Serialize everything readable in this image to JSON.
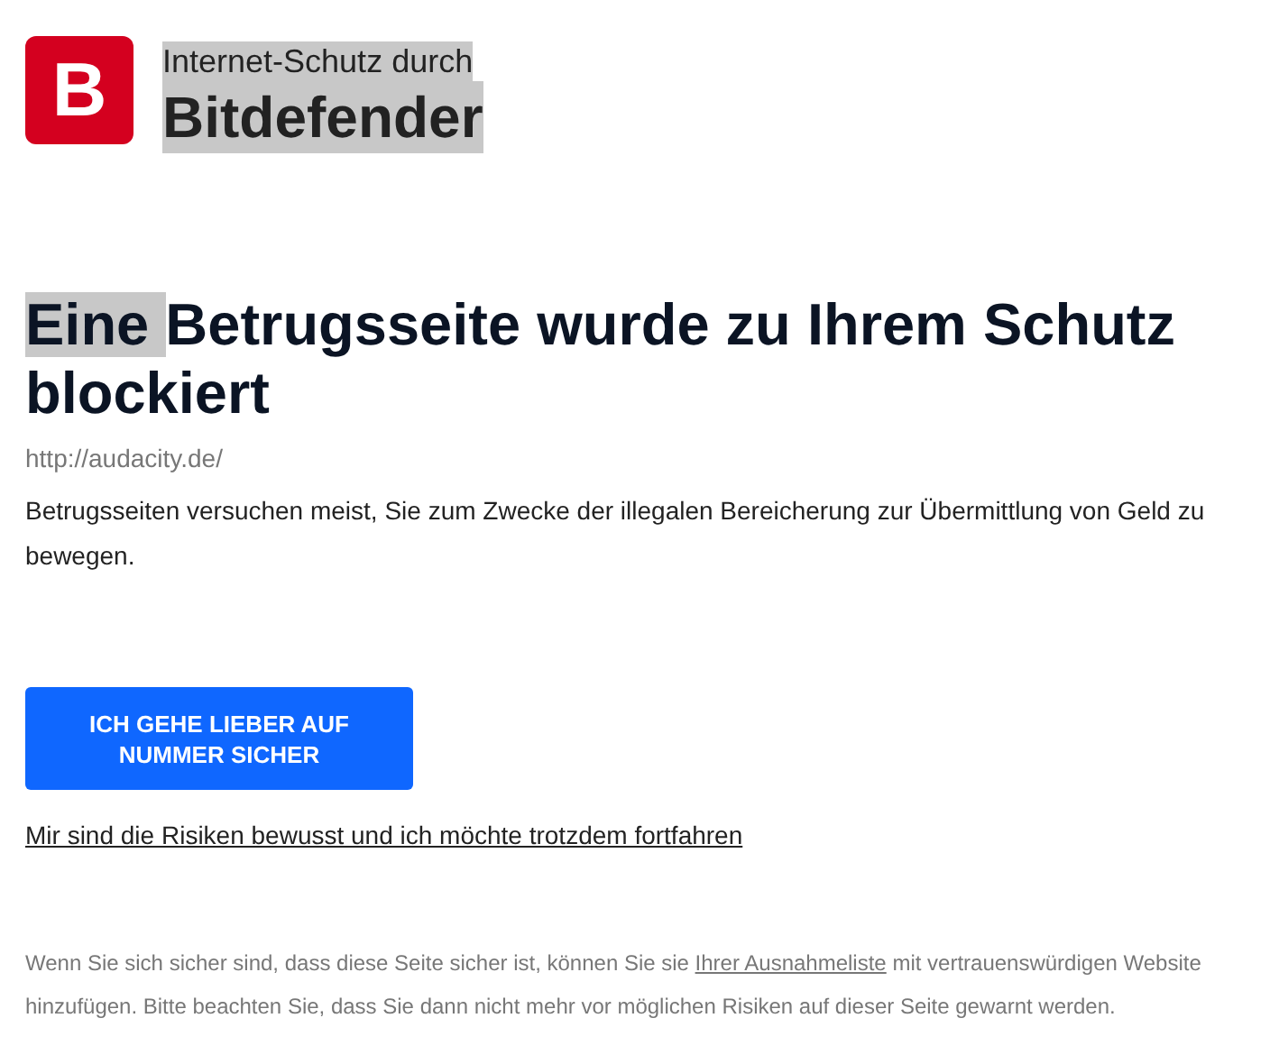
{
  "header": {
    "logo_letter": "B",
    "subtitle": {
      "text": "Internet-Schutz durch",
      "selected": true
    },
    "brand": {
      "text": "Bitdefender",
      "selected": true
    }
  },
  "heading": [
    {
      "text": "Eine ",
      "selected": true
    },
    {
      "text": "Betrugsseite wurde zu Ihrem Schutz blockiert",
      "selected": false
    }
  ],
  "url": "http://audacity.de/",
  "description": "Betrugsseiten versuchen meist, Sie zum Zwecke der illegalen Bereicherung zur Übermittlung von Geld zu bewegen.",
  "primary_button": "ICH GEHE LIEBER AUF NUMMER SICHER",
  "proceed_link": "Mir sind die Risiken bewusst und ich möchte trotzdem fortfahren",
  "footer": {
    "before": "Wenn Sie sich sicher sind, dass diese Seite sicher ist, können Sie sie",
    "link": "Ihrer Ausnahmeliste",
    "after": "mit vertrauenswürdigen Website hinzufügen. Bitte beachten Sie, dass Sie dann nicht mehr vor möglichen Risiken auf dieser Seite gewarnt werden."
  }
}
